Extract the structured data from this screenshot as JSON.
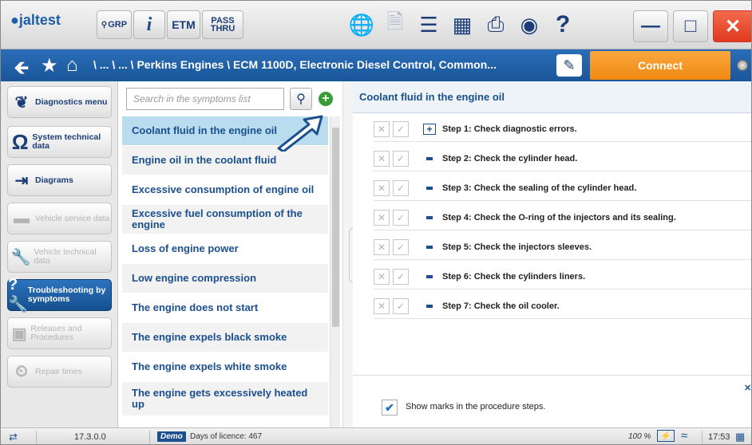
{
  "toolbar": {
    "logo_text": "jaltest",
    "grp_label": "GRP",
    "info_label": "i",
    "etm_label": "ETM",
    "passthru_label": "PASS THRU",
    "help_label": "?"
  },
  "nav": {
    "breadcrumb": "\\ ... \\ ... \\ Perkins Engines \\ ECM 1100D, Electronic Diesel Control, Common...",
    "connect_label": "Connect"
  },
  "sidebar": {
    "items": [
      {
        "label": "Diagnostics menu",
        "state": "normal"
      },
      {
        "label": "System technical data",
        "state": "normal"
      },
      {
        "label": "Diagrams",
        "state": "normal"
      },
      {
        "label": "Vehicle service data",
        "state": "disabled"
      },
      {
        "label": "Vehicle technical data",
        "state": "disabled"
      },
      {
        "label": "Troubleshooting by symptoms",
        "state": "active"
      },
      {
        "label": "Releases and Procedures",
        "state": "disabled"
      },
      {
        "label": "Repair times",
        "state": "disabled"
      }
    ]
  },
  "symptoms": {
    "search_placeholder": "Search in the symptoms list",
    "items": [
      "Coolant fluid in the engine oil",
      "Engine oil in the coolant fluid",
      "Excessive consumption of engine oil",
      "Excessive fuel consumption of the engine",
      "Loss of engine power",
      "Low engine compression",
      "The engine does not start",
      "The engine expels black smoke",
      "The engine expels white smoke",
      "The engine gets excessively heated up"
    ],
    "selected_index": 0
  },
  "procedure": {
    "title": "Coolant fluid in the engine oil",
    "steps": [
      "Step 1: Check diagnostic errors.",
      "Step 2: Check the cylinder head.",
      "Step 3: Check the sealing of the cylinder head.",
      "Step 4: Check the O-ring of the injectors and its sealing.",
      "Step 5: Check the injectors sleeves.",
      "Step 6: Check the cylinders liners.",
      "Step 7: Check the oil cooler."
    ],
    "show_marks_label": "Show marks in the procedure steps.",
    "show_marks_checked": true
  },
  "statusbar": {
    "version": "17.3.0.0",
    "demo_badge": "Demo",
    "licence": "Days of licence: 467",
    "battery": "100 %",
    "time": "17:53"
  },
  "colors": {
    "brand_blue": "#1b4f8d",
    "connect_orange": "#f39420",
    "close_red": "#e8452c",
    "selected_row": "#b9dcef"
  }
}
